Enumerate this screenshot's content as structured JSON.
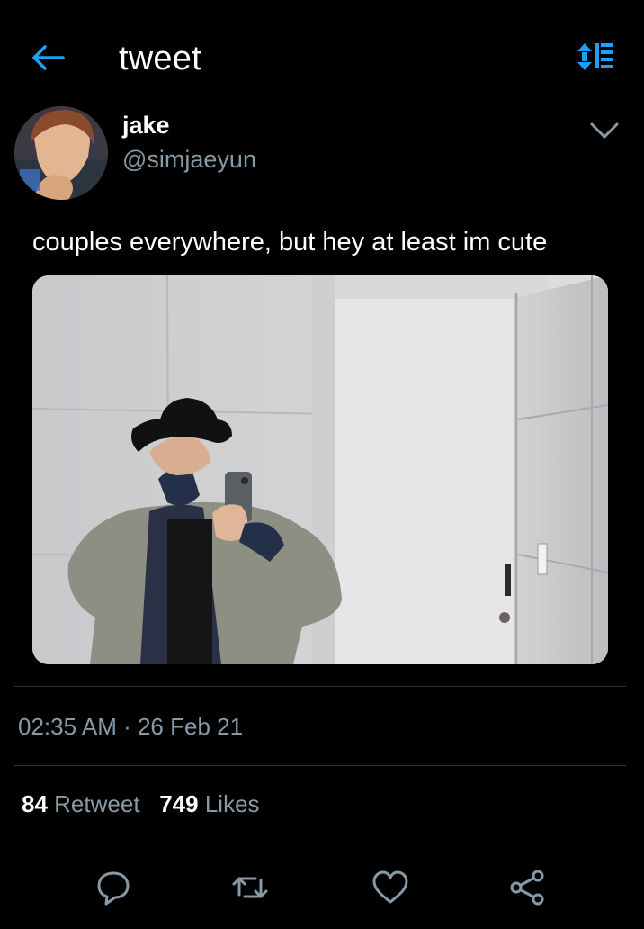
{
  "header": {
    "title": "tweet",
    "back_icon": "arrow-left-icon",
    "sort_icon": "sort-icon",
    "accent_color": "#1da1f2"
  },
  "author": {
    "name": "jake",
    "handle": "@simjaeyun"
  },
  "tweet": {
    "text": "couples everywhere, but hey at least im cute"
  },
  "meta": {
    "timestamp": "02:35 AM · 26 Feb 21"
  },
  "stats": {
    "retweets": "84",
    "retweets_label": "Retweet",
    "likes": "749",
    "likes_label": "Likes"
  },
  "actions": [
    {
      "icon": "reply-icon"
    },
    {
      "icon": "retweet-icon"
    },
    {
      "icon": "like-icon"
    },
    {
      "icon": "share-icon"
    }
  ]
}
